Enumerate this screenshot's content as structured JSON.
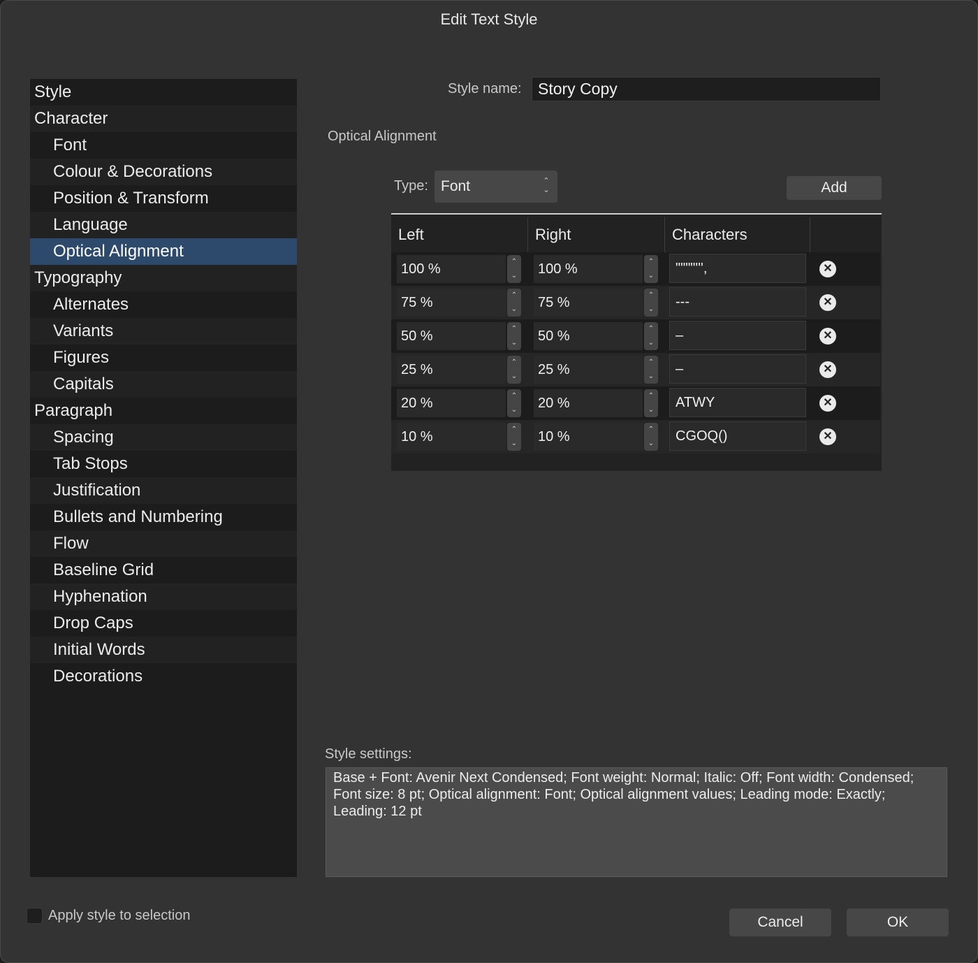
{
  "window": {
    "title": "Edit Text Style"
  },
  "sidebar": {
    "items": [
      {
        "label": "Style",
        "level": 0
      },
      {
        "label": "Character",
        "level": 0
      },
      {
        "label": "Font",
        "level": 1
      },
      {
        "label": "Colour & Decorations",
        "level": 1
      },
      {
        "label": "Position & Transform",
        "level": 1
      },
      {
        "label": "Language",
        "level": 1
      },
      {
        "label": "Optical Alignment",
        "level": 1,
        "selected": true
      },
      {
        "label": "Typography",
        "level": 0
      },
      {
        "label": "Alternates",
        "level": 1
      },
      {
        "label": "Variants",
        "level": 1
      },
      {
        "label": "Figures",
        "level": 1
      },
      {
        "label": "Capitals",
        "level": 1
      },
      {
        "label": "Paragraph",
        "level": 0
      },
      {
        "label": "Spacing",
        "level": 1
      },
      {
        "label": "Tab Stops",
        "level": 1
      },
      {
        "label": "Justification",
        "level": 1
      },
      {
        "label": "Bullets and Numbering",
        "level": 1
      },
      {
        "label": "Flow",
        "level": 1
      },
      {
        "label": "Baseline Grid",
        "level": 1
      },
      {
        "label": "Hyphenation",
        "level": 1
      },
      {
        "label": "Drop Caps",
        "level": 1
      },
      {
        "label": "Initial Words",
        "level": 1
      },
      {
        "label": "Decorations",
        "level": 1
      }
    ]
  },
  "style_name": {
    "label": "Style name:",
    "value": "Story Copy"
  },
  "section": {
    "title": "Optical Alignment"
  },
  "type": {
    "label": "Type:",
    "value": "Font"
  },
  "add_button": {
    "label": "Add"
  },
  "table": {
    "columns": [
      "Left",
      "Right",
      "Characters"
    ],
    "rows": [
      {
        "left": "100 %",
        "right": "100 %",
        "chars": "\"\"\"\"''',"
      },
      {
        "left": "75 %",
        "right": "75 %",
        "chars": "---"
      },
      {
        "left": "50 %",
        "right": "50 %",
        "chars": "–"
      },
      {
        "left": "25 %",
        "right": "25 %",
        "chars": "–"
      },
      {
        "left": "20 %",
        "right": "20 %",
        "chars": "ATWY"
      },
      {
        "left": "10 %",
        "right": "10 %",
        "chars": "CGOQ()"
      }
    ]
  },
  "settings": {
    "label": "Style settings:",
    "text": "Base + Font: Avenir Next Condensed; Font weight: Normal; Italic: Off; Font width: Condensed; Font size: 8 pt; Optical alignment: Font; Optical alignment values; Leading mode: Exactly; Leading: 12 pt"
  },
  "apply": {
    "label": "Apply style to selection"
  },
  "buttons": {
    "cancel": "Cancel",
    "ok": "OK"
  },
  "icons": {
    "stepper": "stepper-icon",
    "delete": "remove-circle-icon",
    "popup": "updown-chevron-icon"
  },
  "colors": {
    "selection": "#2d4a6c",
    "window": "#333333",
    "sidebar": "#1c1c1c"
  }
}
